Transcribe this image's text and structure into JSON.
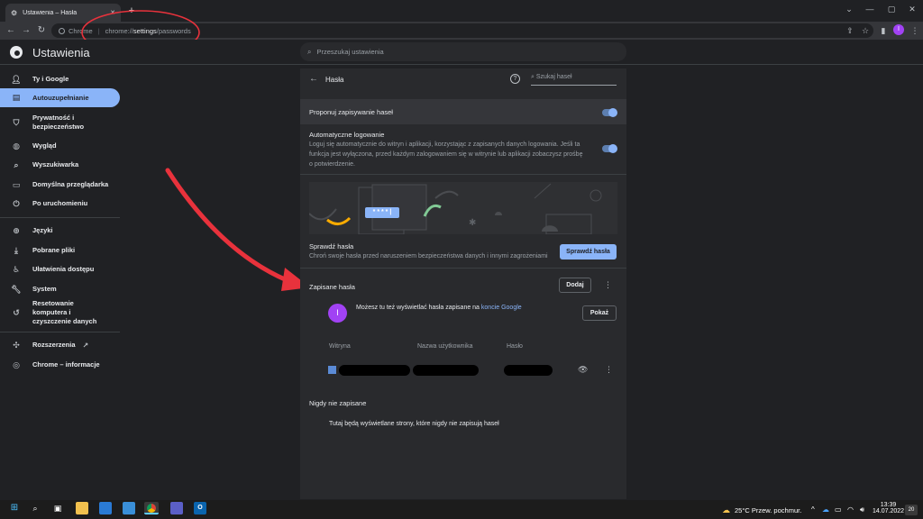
{
  "browser": {
    "tab_title": "Ustawienia – Hasła",
    "tab_close": "✕",
    "new_tab": "+",
    "site_label": "Chrome",
    "url_scheme": "chrome://",
    "url_host": "settings",
    "url_path": "/passwords",
    "profile_initial": "I"
  },
  "settings": {
    "title": "Ustawienia",
    "search_placeholder": "Przeszukaj ustawienia"
  },
  "sidebar": {
    "items": [
      {
        "label": "Ty i Google",
        "icon": "person-icon"
      },
      {
        "label": "Autouzupełnianie",
        "icon": "autofill-icon"
      },
      {
        "label": "Prywatność i bezpieczeństwo",
        "icon": "shield-icon"
      },
      {
        "label": "Wygląd",
        "icon": "palette-icon"
      },
      {
        "label": "Wyszukiwarka",
        "icon": "search-icon"
      },
      {
        "label": "Domyślna przeglądarka",
        "icon": "browser-icon"
      },
      {
        "label": "Po uruchomieniu",
        "icon": "power-icon"
      },
      {
        "label": "Języki",
        "icon": "globe-icon"
      },
      {
        "label": "Pobrane pliki",
        "icon": "download-icon"
      },
      {
        "label": "Ułatwienia dostępu",
        "icon": "accessibility-icon"
      },
      {
        "label": "System",
        "icon": "wrench-icon"
      },
      {
        "label": "Resetowanie komputera i czyszczenie danych",
        "icon": "history-icon"
      },
      {
        "label": "Rozszerzenia",
        "icon": "puzzle-icon"
      },
      {
        "label": "Chrome – informacje",
        "icon": "chrome-icon"
      }
    ]
  },
  "passwords": {
    "header": "Hasła",
    "search_placeholder": "Szukaj haseł",
    "offer_save": "Proponuj zapisywanie haseł",
    "auto_login_title": "Automatyczne logowanie",
    "auto_login_desc": "Loguj się automatycznie do witryn i aplikacji, korzystając z zapisanych danych logowania. Jeśli ta funkcja jest wyłączona, przed każdym zalogowaniem się w witrynie lub aplikacji zobaczysz prośbę o potwierdzenie.",
    "illustration_text": "* * * * |",
    "check_title": "Sprawdź hasła",
    "check_desc": "Chroń swoje hasła przed naruszeniem bezpieczeństwa danych i innymi zagrożeniami",
    "check_button": "Sprawdź hasła",
    "saved_title": "Zapisane hasła",
    "add_button": "Dodaj",
    "account_initial": "I",
    "account_text": "Możesz tu też wyświetlać hasła zapisane na ",
    "account_link": "koncie Google",
    "show_button": "Pokaż",
    "columns": [
      "Witryna",
      "Nazwa użytkownika",
      "Hasło"
    ],
    "never_saved_title": "Nigdy nie zapisane",
    "never_saved_desc": "Tutaj będą wyświetlane strony, które nigdy nie zapisują haseł"
  },
  "taskbar": {
    "weather": "25°C  Przew. pochmur.",
    "time": "13:39",
    "date": "14.07.2022",
    "notifications": "20"
  }
}
